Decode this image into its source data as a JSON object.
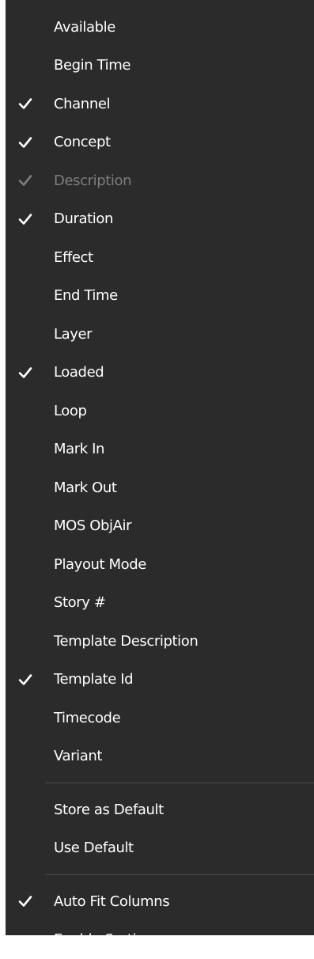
{
  "menu": {
    "columns": [
      {
        "label": "Available",
        "checked": false,
        "disabled": false
      },
      {
        "label": "Begin Time",
        "checked": false,
        "disabled": false
      },
      {
        "label": "Channel",
        "checked": true,
        "disabled": false
      },
      {
        "label": "Concept",
        "checked": true,
        "disabled": false
      },
      {
        "label": "Description",
        "checked": true,
        "disabled": true
      },
      {
        "label": "Duration",
        "checked": true,
        "disabled": false
      },
      {
        "label": "Effect",
        "checked": false,
        "disabled": false
      },
      {
        "label": "End Time",
        "checked": false,
        "disabled": false
      },
      {
        "label": "Layer",
        "checked": false,
        "disabled": false
      },
      {
        "label": "Loaded",
        "checked": true,
        "disabled": false
      },
      {
        "label": "Loop",
        "checked": false,
        "disabled": false
      },
      {
        "label": "Mark In",
        "checked": false,
        "disabled": false
      },
      {
        "label": "Mark Out",
        "checked": false,
        "disabled": false
      },
      {
        "label": "MOS ObjAir",
        "checked": false,
        "disabled": false
      },
      {
        "label": "Playout Mode",
        "checked": false,
        "disabled": false
      },
      {
        "label": "Story #",
        "checked": false,
        "disabled": false
      },
      {
        "label": "Template Description",
        "checked": false,
        "disabled": false
      },
      {
        "label": "Template Id",
        "checked": true,
        "disabled": false
      },
      {
        "label": "Timecode",
        "checked": false,
        "disabled": false
      },
      {
        "label": "Variant",
        "checked": false,
        "disabled": false
      }
    ],
    "defaults": [
      {
        "label": "Store as Default",
        "checked": false,
        "disabled": false
      },
      {
        "label": "Use Default",
        "checked": false,
        "disabled": false
      }
    ],
    "options": [
      {
        "label": "Auto Fit Columns",
        "checked": true,
        "disabled": false
      },
      {
        "label": "Enable Sorting",
        "checked": false,
        "disabled": false
      }
    ]
  },
  "icons": {
    "check": "checkmark-icon"
  },
  "colors": {
    "menu_bg": "#2b2b2b",
    "text": "#ffffff",
    "disabled_text": "#7d7d7d",
    "separator": "#4a4a4a"
  }
}
